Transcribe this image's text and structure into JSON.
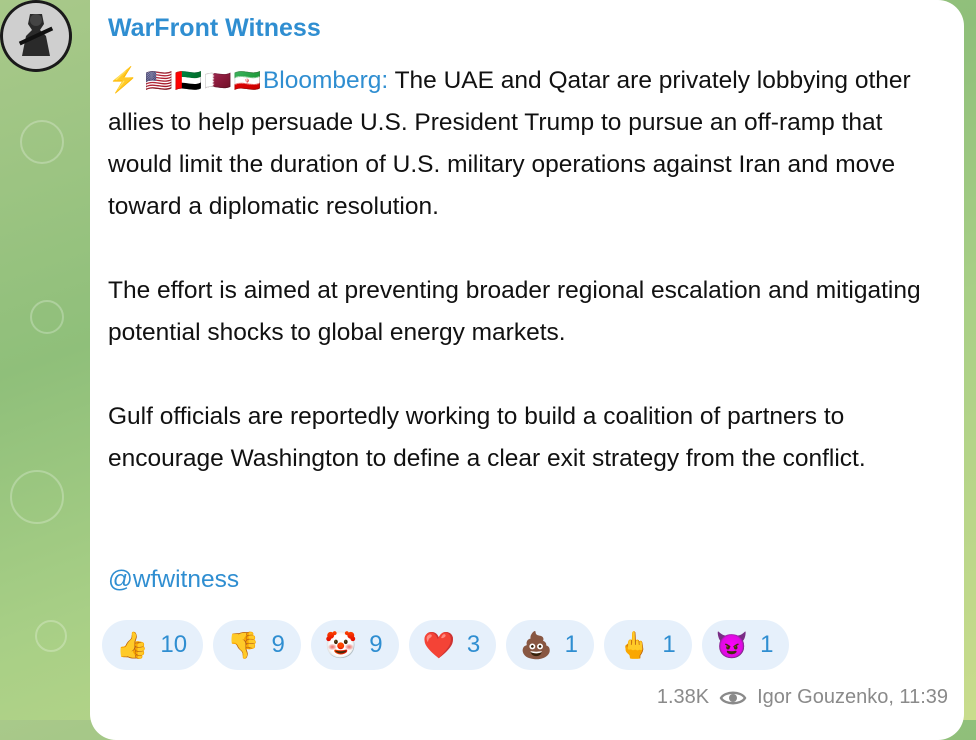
{
  "post": {
    "channel_name": "WarFront Witness",
    "prefix_emoji": "⚡",
    "flags": "🇺🇸🇦🇪🇶🇦🇮🇷",
    "source": "Bloomberg:",
    "paragraph1": " The UAE and Qatar are privately lobbying other allies to help persuade U.S. President Trump to pursue an off-ramp that would limit the duration of U.S. military operations against Iran and move toward a diplomatic resolution.",
    "paragraph2": "The effort is aimed at preventing broader regional escalation and mitigating potential shocks to global energy markets.",
    "paragraph3": "Gulf officials are reportedly working to build a coalition of partners to encourage Washington to define a clear exit strategy from the conflict.",
    "handle": "@wfwitness"
  },
  "reactions": [
    {
      "emoji": "👍",
      "count": "10"
    },
    {
      "emoji": "👎",
      "count": "9"
    },
    {
      "emoji": "🤡",
      "count": "9"
    },
    {
      "emoji": "❤️",
      "count": "3"
    },
    {
      "emoji": "💩",
      "count": "1"
    },
    {
      "emoji": "🖕",
      "count": "1"
    },
    {
      "emoji": "😈",
      "count": "1"
    }
  ],
  "footer": {
    "views": "1.38K",
    "author_time": "Igor Gouzenko, 11:39"
  },
  "colors": {
    "accent": "#2f8ed1",
    "reaction_bg": "#e6f0fb",
    "meta_text": "#8a8a8a"
  },
  "icons": {
    "views": "eye-icon"
  }
}
